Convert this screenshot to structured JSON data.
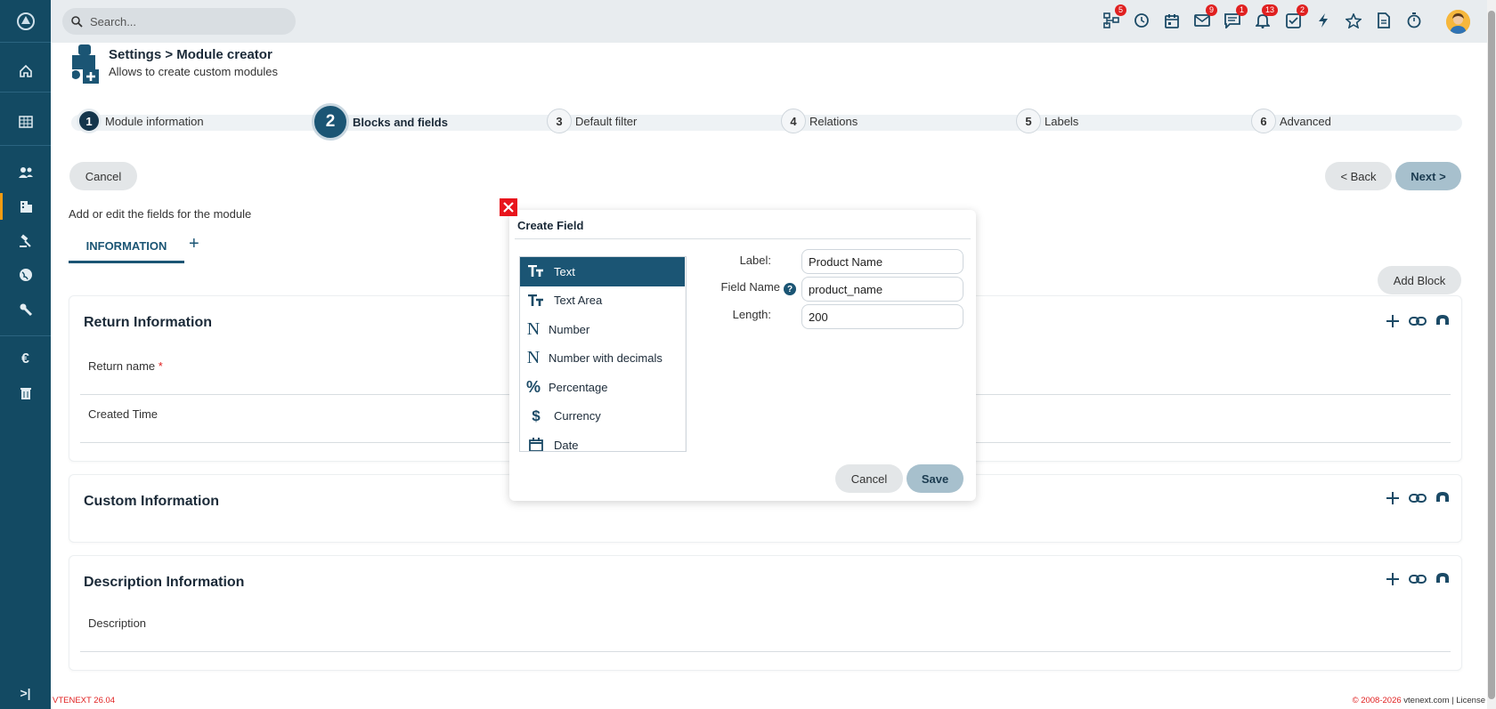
{
  "topbar": {
    "search_placeholder": "Search...",
    "badges": {
      "processes": "5",
      "mail": "9",
      "chat": "1",
      "notifications": "13",
      "tasks": "2"
    }
  },
  "header": {
    "title": "Settings > Module creator",
    "subtitle": "Allows to create custom modules"
  },
  "steps": [
    {
      "num": "1",
      "label": "Module information"
    },
    {
      "num": "2",
      "label": "Blocks and fields"
    },
    {
      "num": "3",
      "label": "Default filter"
    },
    {
      "num": "4",
      "label": "Relations"
    },
    {
      "num": "5",
      "label": "Labels"
    },
    {
      "num": "6",
      "label": "Advanced"
    }
  ],
  "buttons": {
    "cancel": "Cancel",
    "back": "< Back",
    "next": "Next >",
    "add_block": "Add Block"
  },
  "intro": "Add or edit the fields for the module",
  "tabs": {
    "information": "INFORMATION"
  },
  "blocks": [
    {
      "title": "Return Information",
      "fields": [
        "Return name",
        "Created Time"
      ]
    },
    {
      "title": "Custom Information",
      "fields": []
    },
    {
      "title": "Description Information",
      "fields": [
        "Description"
      ]
    }
  ],
  "required_mark": "*",
  "modal": {
    "title": "Create Field",
    "types": [
      {
        "label": "Text",
        "icon": "text-type-icon"
      },
      {
        "label": "Text Area",
        "icon": "text-type-icon"
      },
      {
        "label": "Number",
        "icon": "number-icon"
      },
      {
        "label": "Number with decimals",
        "icon": "number-icon"
      },
      {
        "label": "Percentage",
        "icon": "percent-icon"
      },
      {
        "label": "Currency",
        "icon": "dollar-icon"
      },
      {
        "label": "Date",
        "icon": "calendar-icon"
      }
    ],
    "label_caption": "Label:",
    "label_value": "Product Name",
    "fieldname_caption": "Field Name",
    "fieldname_value": "product_name",
    "length_caption": "Length:",
    "length_value": "200",
    "cancel": "Cancel",
    "save": "Save"
  },
  "footer": {
    "version": "VTENEXT 26.04",
    "copyright": "© 2008-2026",
    "site": "vtenext.com",
    "license": "License"
  },
  "colors": {
    "primary": "#1b5574",
    "sidebar": "#134a63",
    "accent": "#f39c12",
    "danger": "#e02020"
  }
}
